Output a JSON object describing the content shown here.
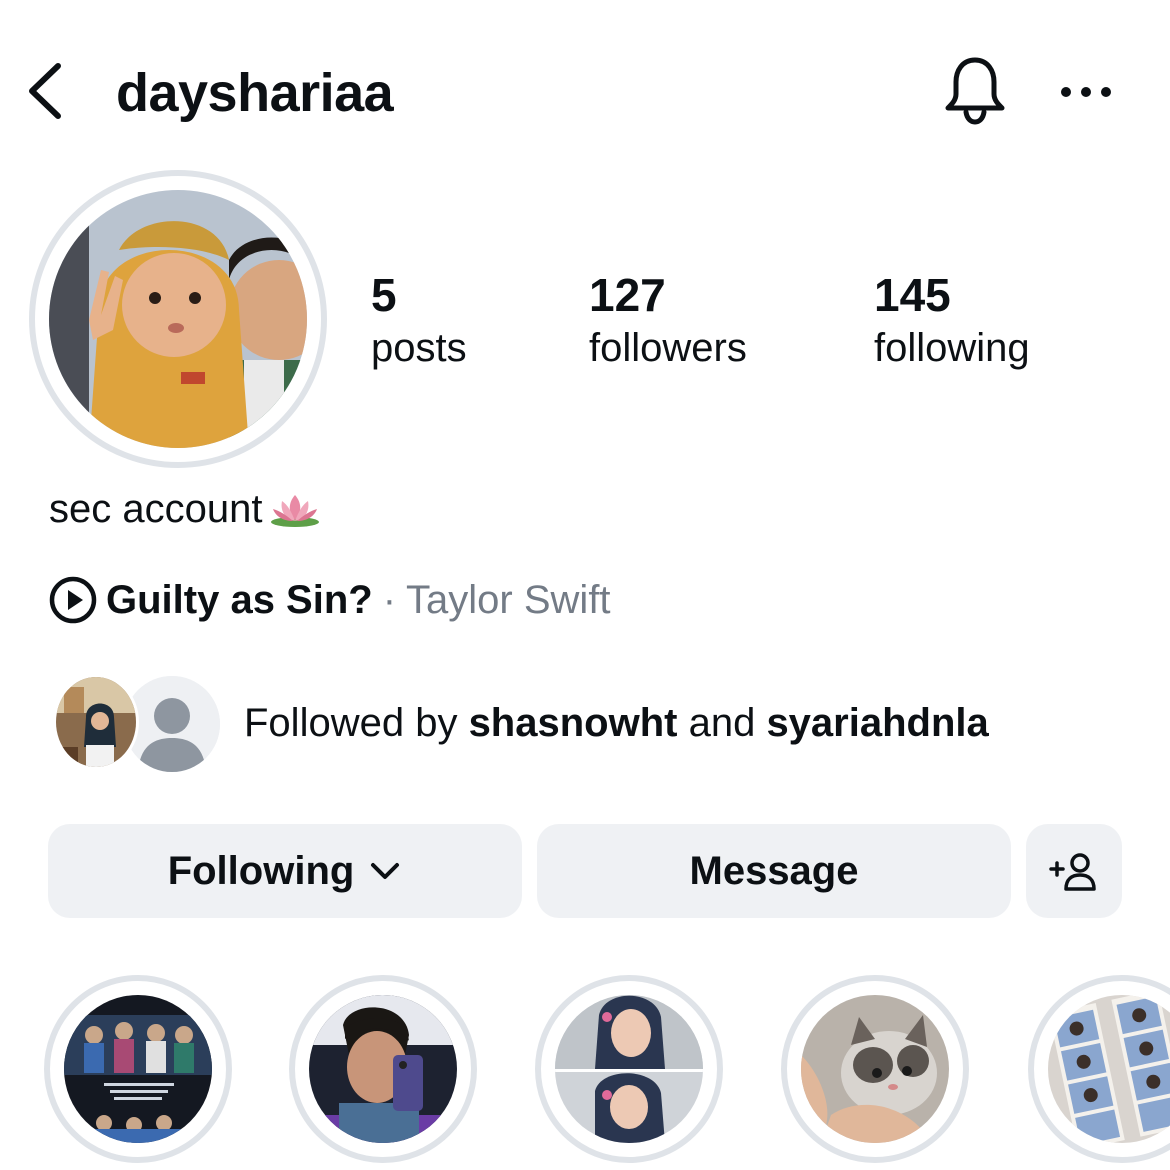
{
  "header": {
    "username": "dayshariaa",
    "back_icon": "chevron-left-icon",
    "notify_icon": "bell-icon",
    "more_icon": "more-horizontal-icon"
  },
  "stats": [
    {
      "value": "5",
      "label": "posts"
    },
    {
      "value": "127",
      "label": "followers"
    },
    {
      "value": "145",
      "label": "following"
    }
  ],
  "bio": {
    "text": "sec account",
    "emoji_icon": "lotus-icon"
  },
  "music": {
    "song": "Guilty as Sin?",
    "separator": "·",
    "artist": "Taylor Swift"
  },
  "followed_by": {
    "prefix": "Followed by ",
    "user1": "shasnowht",
    "joiner": " and ",
    "user2": "syariahdnla"
  },
  "actions": {
    "following_label": "Following",
    "message_label": "Message"
  },
  "colors": {
    "button_bg": "#eff1f4",
    "ring": "#dfe3e8",
    "secondary_text": "#737b86"
  }
}
